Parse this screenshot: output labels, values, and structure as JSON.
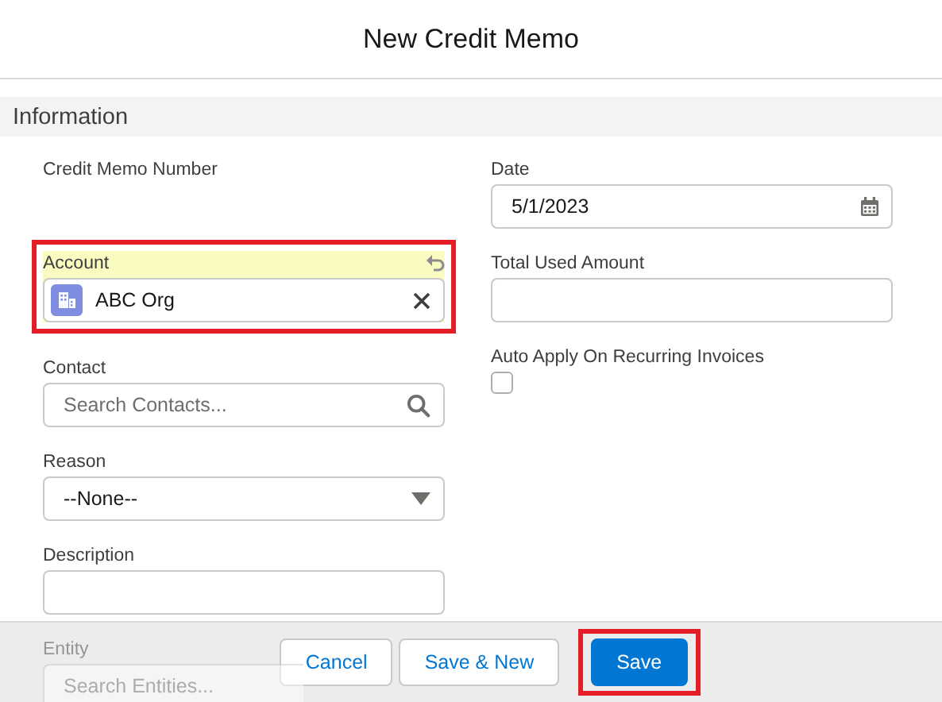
{
  "modal": {
    "title": "New Credit Memo"
  },
  "section": {
    "title": "Information"
  },
  "left_fields": [
    {
      "kind": "readonly",
      "label": "Credit Memo Number"
    },
    {
      "kind": "lookup",
      "label": "Account",
      "value": "ABC Org",
      "modified": true,
      "highlighted": true
    },
    {
      "kind": "search",
      "label": "Contact",
      "placeholder": "Search Contacts..."
    },
    {
      "kind": "select",
      "label": "Reason",
      "value": "--None--"
    },
    {
      "kind": "text",
      "label": "Description"
    },
    {
      "kind": "search",
      "label": "Entity",
      "placeholder": "Search Entities...",
      "partly_hidden": true
    }
  ],
  "right_fields": [
    {
      "kind": "date",
      "label": "Date",
      "value": "5/1/2023"
    },
    {
      "kind": "text",
      "label": "Total Used Amount"
    },
    {
      "kind": "checkbox",
      "label": "Auto Apply On Recurring Invoices",
      "checked": false
    }
  ],
  "buttons": [
    {
      "label": "Cancel",
      "kind": "neutral",
      "highlighted": false
    },
    {
      "label": "Save & New",
      "kind": "neutral",
      "highlighted": false
    },
    {
      "label": "Save",
      "kind": "brand",
      "highlighted": true
    }
  ]
}
